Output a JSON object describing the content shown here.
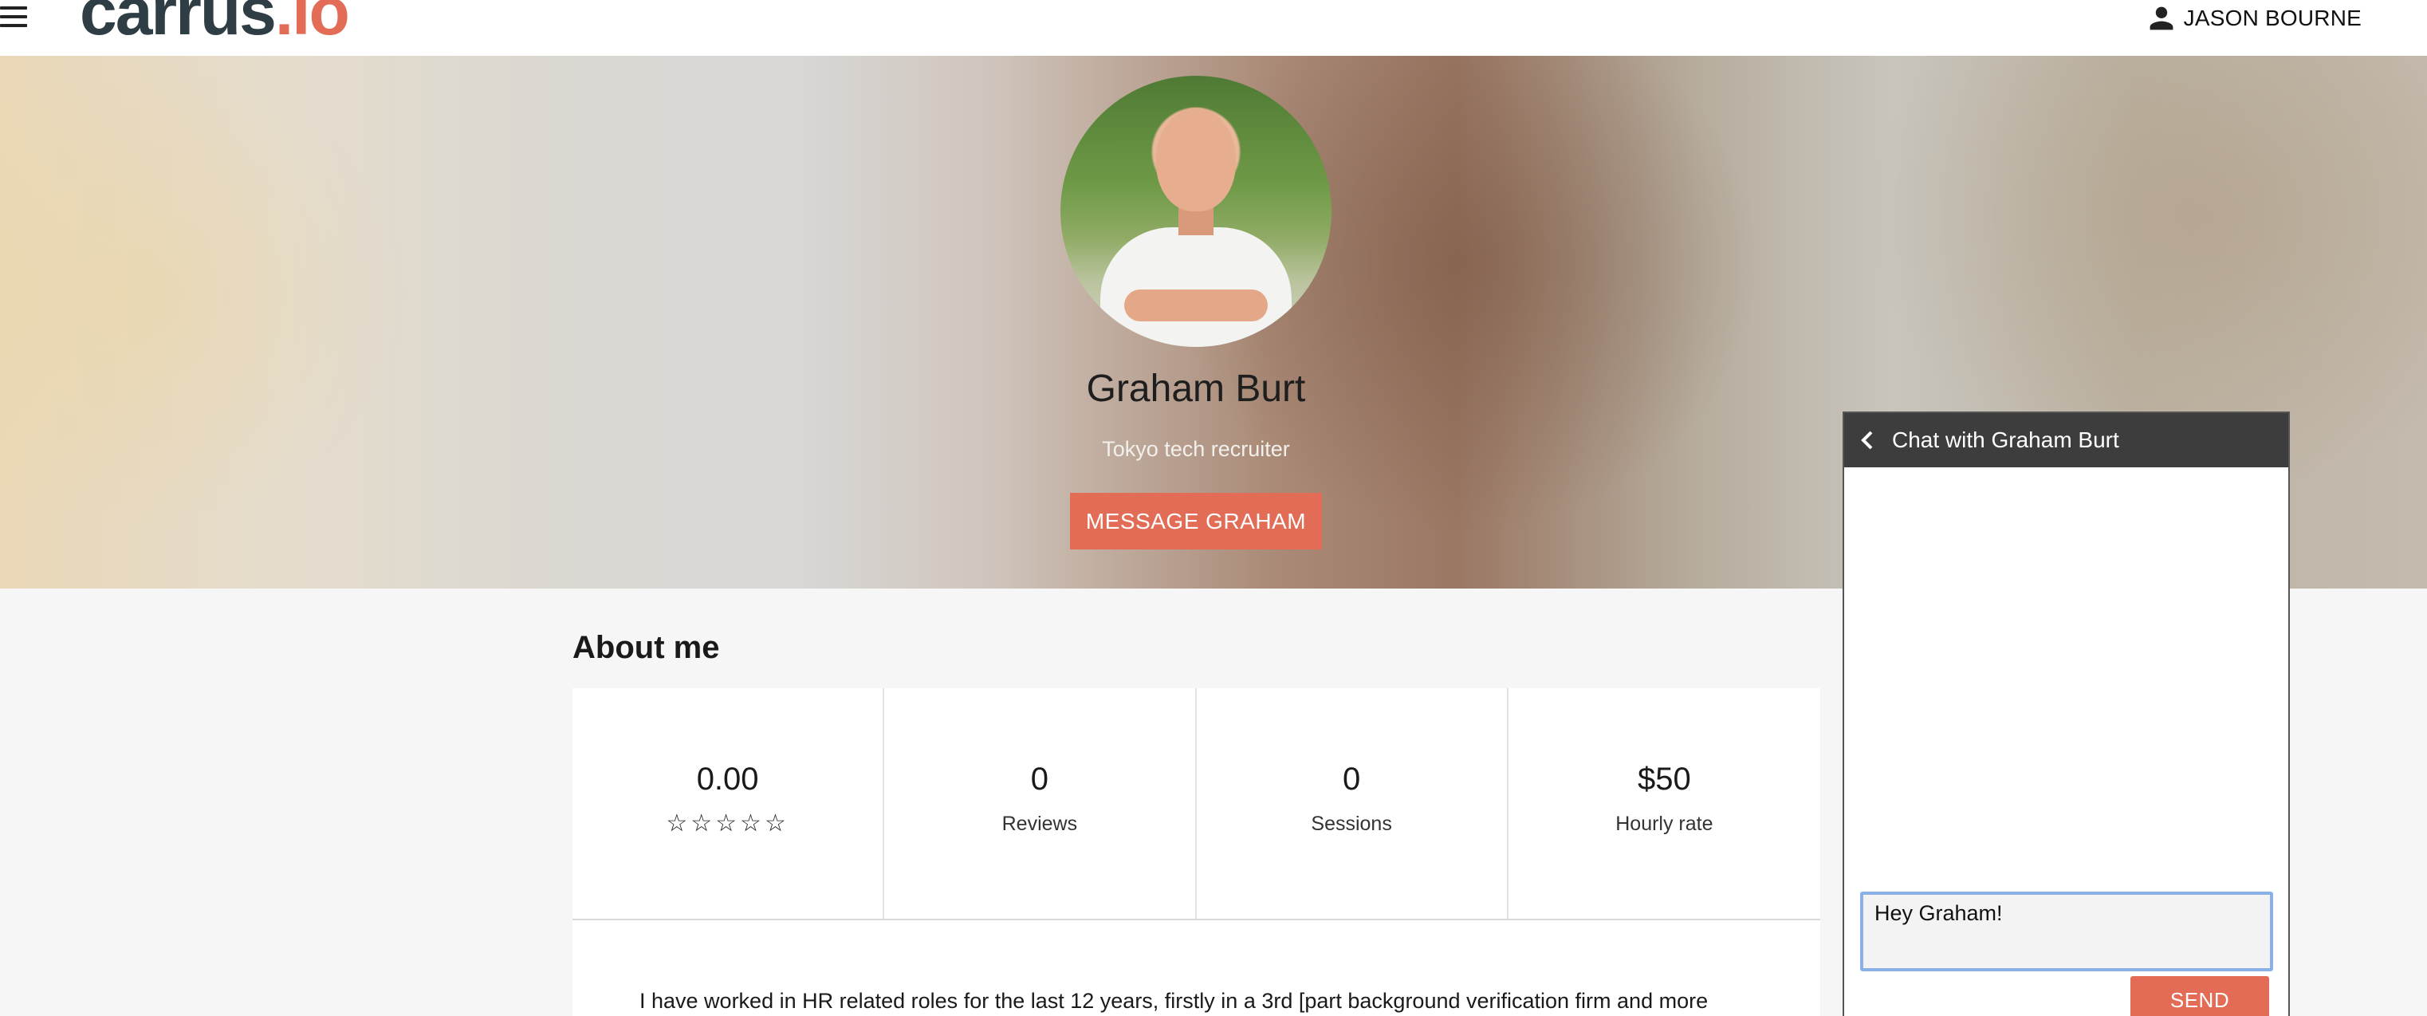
{
  "header": {
    "logo_main": "carrus",
    "logo_accent": ".io",
    "user_name": "JASON BOURNE",
    "icons": [
      "menu-icon",
      "person-icon"
    ]
  },
  "profile": {
    "name": "Graham Burt",
    "subtitle": "Tokyo tech recruiter",
    "message_button": "MESSAGE GRAHAM"
  },
  "about": {
    "title": "About me",
    "stats": [
      {
        "value": "0.00",
        "stars": "☆☆☆☆☆",
        "label": ""
      },
      {
        "value": "0",
        "label": "Reviews"
      },
      {
        "value": "0",
        "label": "Sessions"
      },
      {
        "value": "$50",
        "label": "Hourly rate"
      }
    ],
    "rating_out_of_5": 0,
    "bio": "I have worked in HR related roles for the last 12 years, firstly in a 3rd [part background verification firm and more"
  },
  "chat": {
    "title": "Chat with Graham Burt",
    "input_value": "Hey Graham!",
    "send_button": "SEND"
  },
  "colors": {
    "accent": "#e26c56",
    "logo_dark": "#2f3d45",
    "chat_header": "#3d3d3d",
    "input_focus": "#8ab0e8"
  }
}
